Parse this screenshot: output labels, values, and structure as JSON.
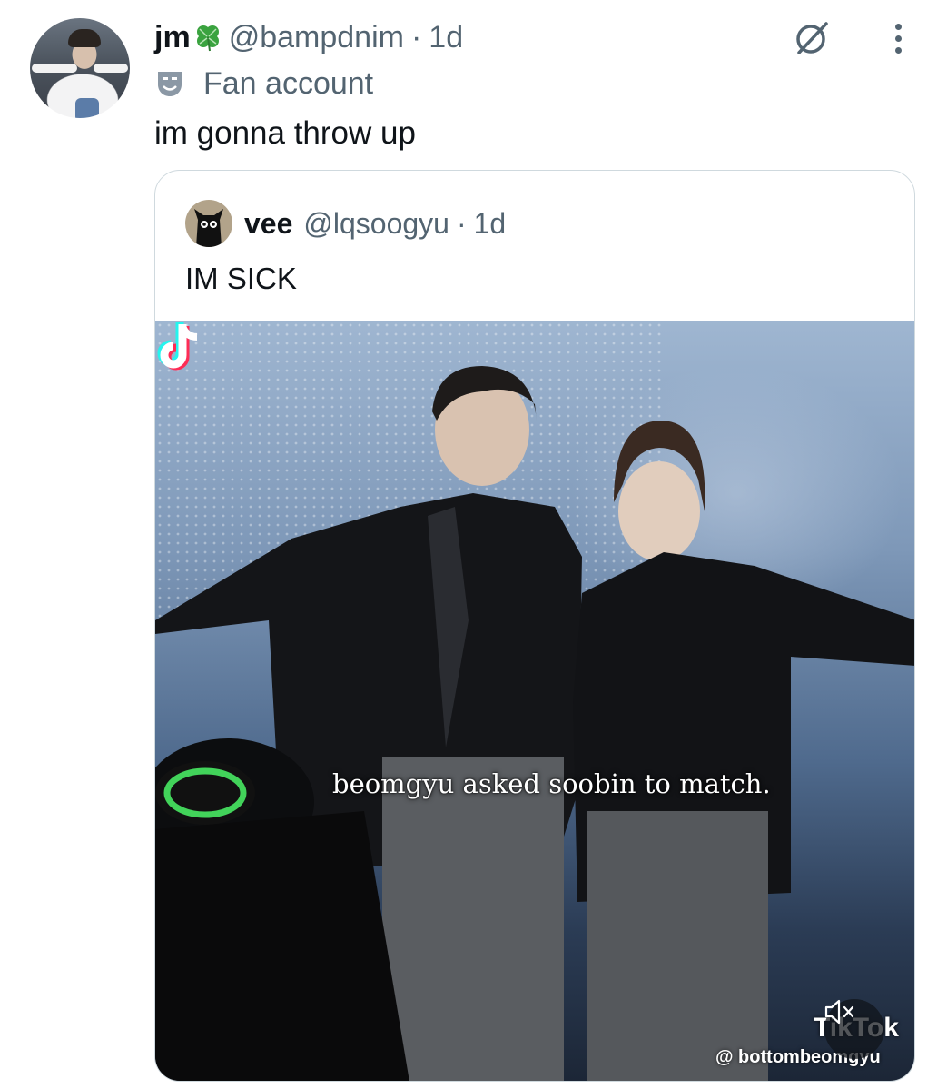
{
  "tweet": {
    "author_name": "jm",
    "author_emoji": "clover-icon",
    "handle": "@bampdnim",
    "separator": "·",
    "time": "1d",
    "label_icon": "theater-mask-icon",
    "label": "Fan account",
    "text": "im gonna throw up"
  },
  "quoted_tweet": {
    "author_name": "vee",
    "handle": "@lqsoogyu",
    "separator": "·",
    "time": "1d",
    "text": "IM SICK",
    "media": {
      "caption": "beomgyu asked soobin to match.",
      "watermark_word": "TikTok",
      "watermark_user": "@ bottombeomgyu",
      "mute_icon": "speaker-muted-icon"
    }
  },
  "icons": {
    "grok": "grok-icon",
    "more": "more-options-icon"
  },
  "colors": {
    "secondary_text": "#536471",
    "border": "#cfd9de",
    "clover_green": "#3aa33f"
  }
}
